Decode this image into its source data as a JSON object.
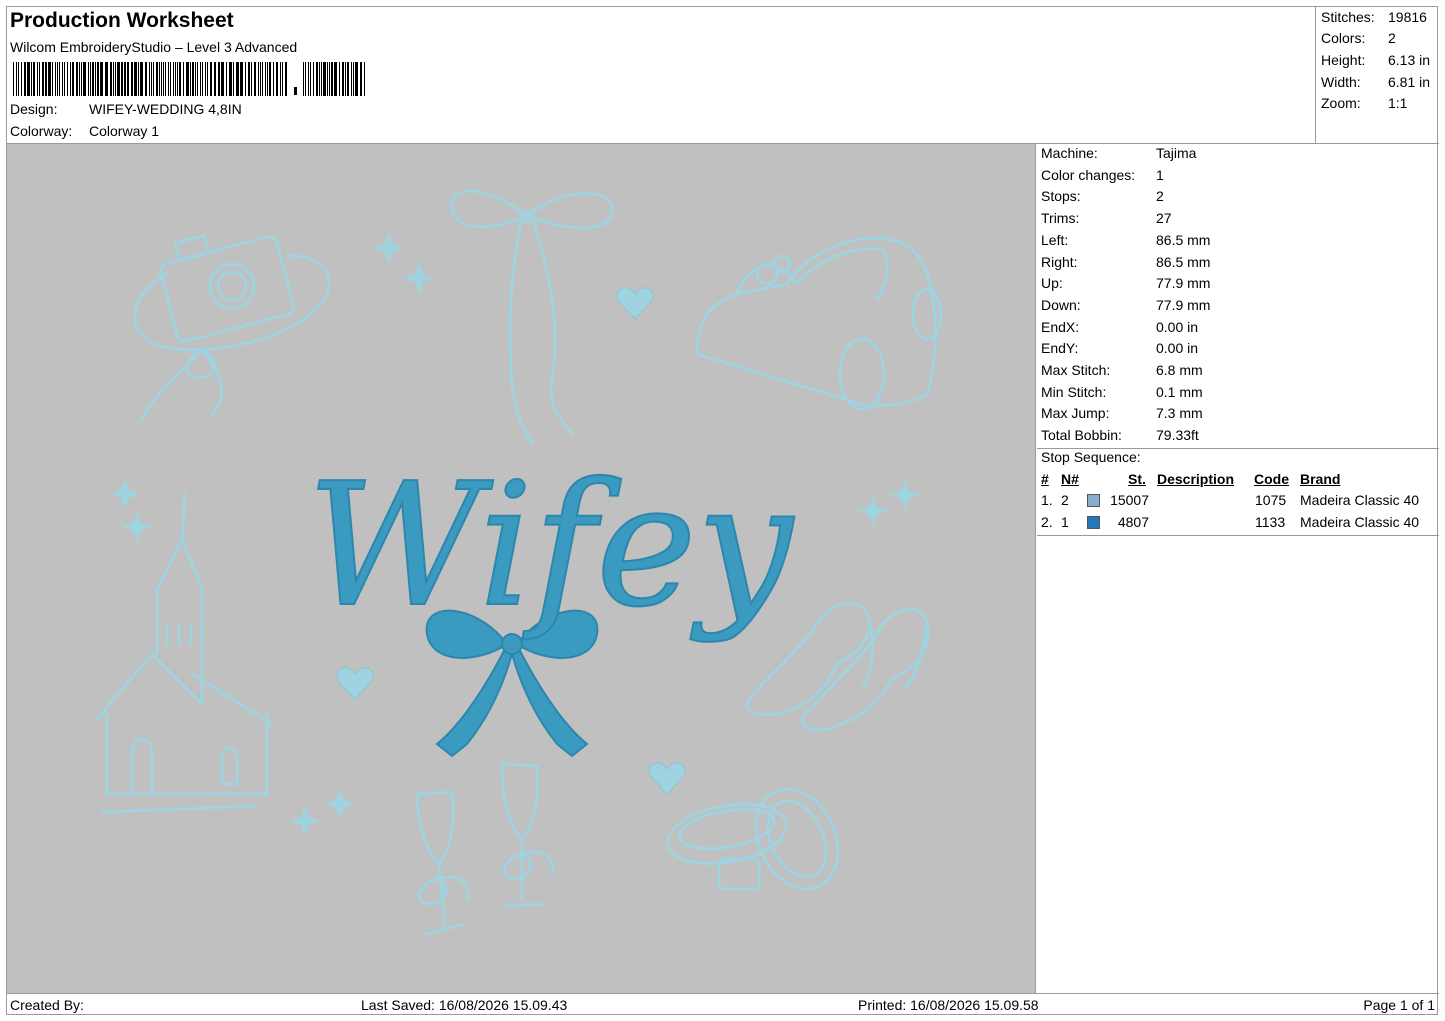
{
  "header": {
    "title": "Production Worksheet",
    "software": "Wilcom EmbroideryStudio – Level 3 Advanced",
    "design_label": "Design:",
    "design_value": "WIFEY-WEDDING 4,8IN",
    "colorway_label": "Colorway:",
    "colorway_value": "Colorway 1"
  },
  "stats": {
    "stitches_label": "Stitches:",
    "stitches_value": "19816",
    "colors_label": "Colors:",
    "colors_value": "2",
    "height_label": "Height:",
    "height_value": "6.13 in",
    "width_label": "Width:",
    "width_value": "6.81 in",
    "zoom_label": "Zoom:",
    "zoom_value": "1:1"
  },
  "machine_info": [
    {
      "label": "Machine:",
      "value": "Tajima"
    },
    {
      "label": "Color changes:",
      "value": "1"
    },
    {
      "label": "Stops:",
      "value": "2"
    },
    {
      "label": "Trims:",
      "value": "27"
    },
    {
      "label": "Left:",
      "value": "86.5 mm"
    },
    {
      "label": "Right:",
      "value": "86.5 mm"
    },
    {
      "label": "Up:",
      "value": "77.9 mm"
    },
    {
      "label": "Down:",
      "value": "77.9 mm"
    },
    {
      "label": "EndX:",
      "value": "0.00 in"
    },
    {
      "label": "EndY:",
      "value": "0.00 in"
    },
    {
      "label": "Max Stitch:",
      "value": "6.8 mm"
    },
    {
      "label": "Min Stitch:",
      "value": "0.1 mm"
    },
    {
      "label": "Max Jump:",
      "value": "7.3 mm"
    },
    {
      "label": "Total Bobbin:",
      "value": "79.33ft"
    }
  ],
  "stop_sequence": {
    "title": "Stop Sequence:",
    "headers": {
      "num": "#",
      "n": "N#",
      "st": "St.",
      "description": "Description",
      "code": "Code",
      "brand": "Brand"
    },
    "rows": [
      {
        "num": "1.",
        "n": "2",
        "color": "#8aaed0",
        "st": "15007",
        "description": "",
        "code": "1075",
        "brand": "Madeira Classic 40"
      },
      {
        "num": "2.",
        "n": "1",
        "color": "#2379b8",
        "st": "4807",
        "description": "",
        "code": "1133",
        "brand": "Madeira Classic 40"
      }
    ]
  },
  "design_preview": {
    "text": "Wifey",
    "thread_light": "#9fd3e0",
    "thread_dark": "#3a9ac0",
    "background": "#c0c0c0"
  },
  "footer": {
    "created_by": "Created By:",
    "last_saved": "Last Saved: 16/08/2026 15.09.43",
    "printed": "Printed: 16/08/2026 15.09.58",
    "page": "Page 1 of 1"
  }
}
